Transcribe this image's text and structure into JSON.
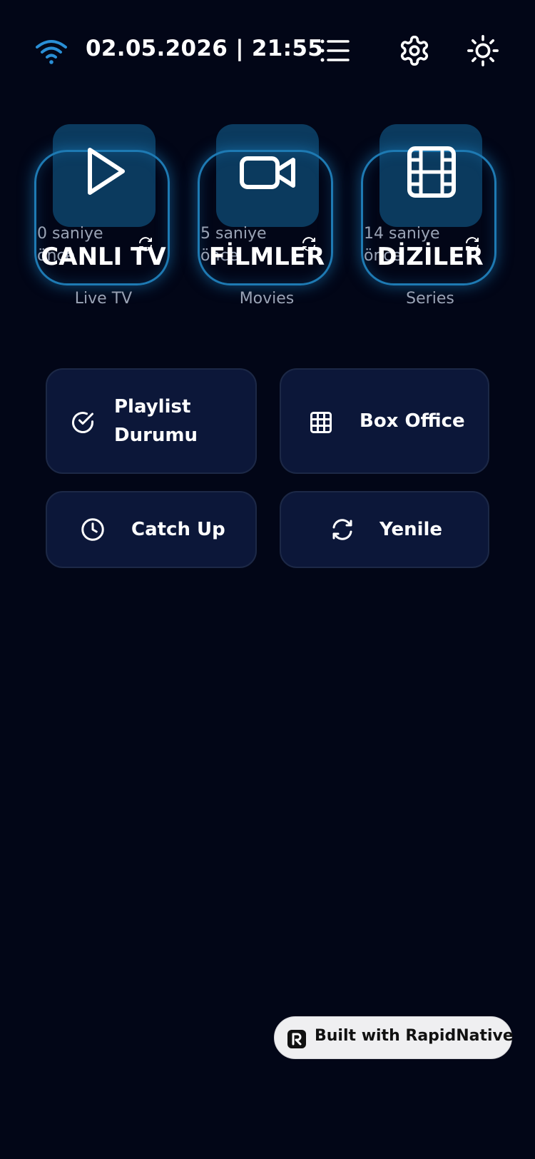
{
  "status_bar": {
    "datetime": "02.05.2026 | 21:55",
    "icons": [
      "wifi-icon",
      "list-icon",
      "gear-icon",
      "sun-icon"
    ]
  },
  "categories": [
    {
      "title": "CANLI TV",
      "subtitle": "Live TV",
      "updated_ago": "0 saniye önce",
      "icon": "play-icon"
    },
    {
      "title": "FİLMLER",
      "subtitle": "Movies",
      "updated_ago": "5 saniye önce",
      "icon": "video-camera-icon"
    },
    {
      "title": "DİZİLER",
      "subtitle": "Series",
      "updated_ago": "14 saniye önce",
      "icon": "film-icon"
    }
  ],
  "actions": [
    {
      "label": "Playlist Durumu",
      "icon": "check-circle-icon"
    },
    {
      "label": "Box Office",
      "icon": "grid-icon"
    },
    {
      "label": "Catch Up",
      "icon": "clock-icon"
    },
    {
      "label": "Yenile",
      "icon": "refresh-icon"
    }
  ],
  "badge": {
    "label": "Built with RapidNative"
  },
  "colors": {
    "background": "#020617",
    "accent": "#1e7ab3",
    "wifi": "#2a8fd6",
    "card_tile": "#0b3a5e",
    "button_bg": "#0c1739",
    "muted_text": "#9aa3b5"
  }
}
